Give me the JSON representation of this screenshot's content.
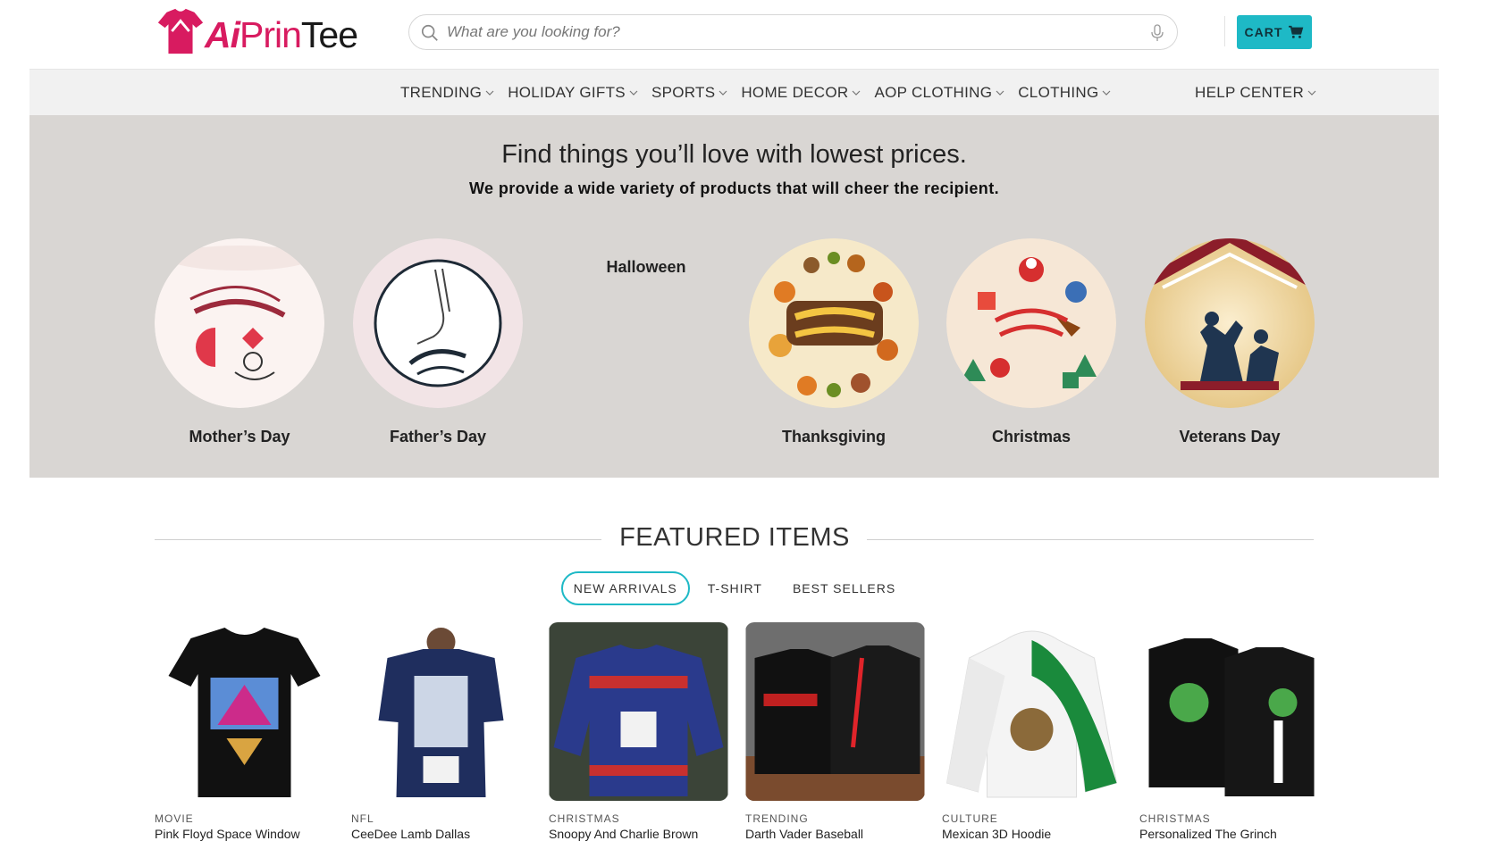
{
  "header": {
    "logo": {
      "a": "Ai",
      "prin": "Prin",
      "tee": "Tee"
    },
    "search": {
      "placeholder": "What are you looking for?"
    },
    "cart_label": "CART",
    "accent_color": "#1eb9c6",
    "icons": {
      "search": "search-icon",
      "mic": "microphone-icon",
      "cart": "cart-icon"
    }
  },
  "nav": {
    "items": [
      "TRENDING",
      "HOLIDAY GIFTS",
      "SPORTS",
      "HOME DECOR",
      "AOP CLOTHING",
      "CLOTHING"
    ],
    "help": "HELP CENTER"
  },
  "hero": {
    "title": "Find things you’ll love with lowest prices.",
    "subtitle": "We provide a wide variety of products that will cheer the recipient.",
    "categories": [
      {
        "label": "Mother’s Day"
      },
      {
        "label": "Father’s Day"
      },
      {
        "label": "Halloween"
      },
      {
        "label": "Thanksgiving"
      },
      {
        "label": "Christmas"
      },
      {
        "label": "Veterans Day"
      }
    ],
    "background": "#d9d6d3"
  },
  "featured": {
    "title": "FEATURED ITEMS",
    "tabs": [
      "NEW ARRIVALS",
      "T-SHIRT",
      "BEST SELLERS"
    ],
    "active_tab": "NEW ARRIVALS",
    "products": [
      {
        "category": "MOVIE",
        "name": "Pink Floyd Space Window"
      },
      {
        "category": "NFL",
        "name": "CeeDee Lamb Dallas"
      },
      {
        "category": "CHRISTMAS",
        "name": "Snoopy And Charlie Brown"
      },
      {
        "category": "TRENDING",
        "name": "Darth Vader Baseball"
      },
      {
        "category": "CULTURE",
        "name": "Mexican 3D Hoodie"
      },
      {
        "category": "CHRISTMAS",
        "name": "Personalized The Grinch"
      }
    ]
  }
}
